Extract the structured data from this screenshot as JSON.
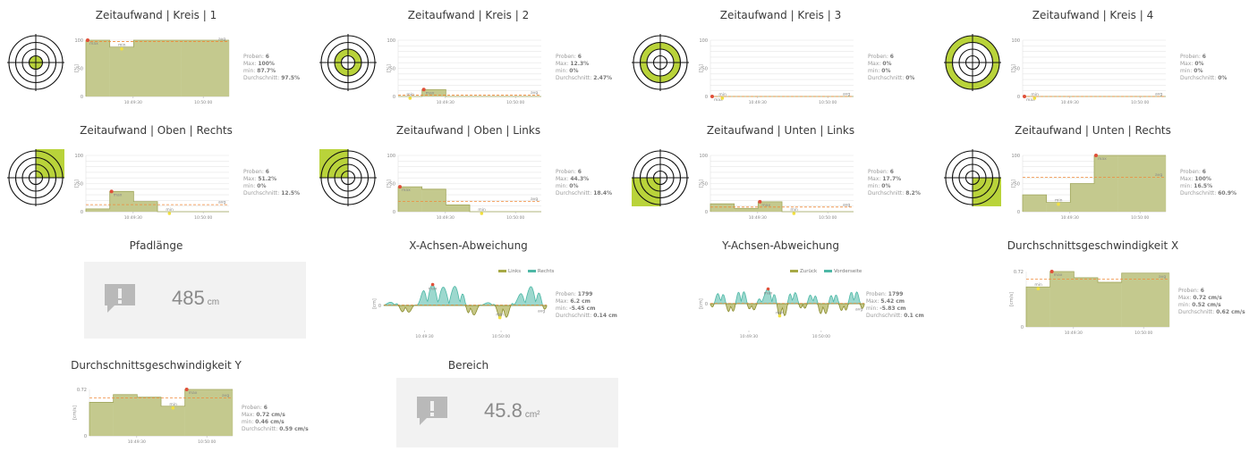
{
  "colors": {
    "bar_fill": "#c4c98e",
    "bar_stroke": "#a2a85e",
    "accent": "#b9d33a",
    "avg_line": "#f08a3a",
    "max_line": "#f08a3a",
    "max_dot": "#e0503a",
    "min_dot": "#f2e040",
    "teal": "#4db8a6",
    "olive": "#a7a946",
    "tile_bg": "#f2f2f2",
    "tile_icon": "#b9b9b9"
  },
  "time_ticks": [
    "10:49:30",
    "10:50:00"
  ],
  "marker_labels": {
    "max": "max",
    "min": "min",
    "avg": "avg"
  },
  "stat_labels": {
    "samples": "Proben:",
    "max": "Max:",
    "min": "min:",
    "avg": "Durchschnitt:"
  },
  "percent_axis": {
    "ticks": [
      "0",
      "50",
      "100"
    ],
    "unit": "[%]"
  },
  "panels": [
    {
      "title": "Zeitaufwand | Kreis | 1",
      "target_zone": "ring1",
      "stats": {
        "samples": "6",
        "max": "100%",
        "min": "87.7%",
        "avg": "97.5%"
      },
      "chart_data": {
        "type": "bar",
        "y_unit": "%",
        "ylim": [
          0,
          100
        ],
        "values": [
          100,
          87.7,
          100,
          100,
          100,
          100
        ],
        "avg": 97.5
      }
    },
    {
      "title": "Zeitaufwand | Kreis | 2",
      "target_zone": "ring2",
      "stats": {
        "samples": "6",
        "max": "12.3%",
        "min": "0%",
        "avg": "2.47%"
      },
      "chart_data": {
        "type": "bar",
        "y_unit": "%",
        "ylim": [
          0,
          100
        ],
        "values": [
          0,
          12.3,
          0,
          0,
          0,
          0
        ],
        "avg": 2.47
      }
    },
    {
      "title": "Zeitaufwand | Kreis | 3",
      "target_zone": "ring3",
      "stats": {
        "samples": "6",
        "max": "0%",
        "min": "0%",
        "avg": "0%"
      },
      "chart_data": {
        "type": "bar",
        "y_unit": "%",
        "ylim": [
          0,
          100
        ],
        "values": [
          0,
          0,
          0,
          0,
          0,
          0
        ],
        "avg": 0
      }
    },
    {
      "title": "Zeitaufwand | Kreis | 4",
      "target_zone": "ring4",
      "stats": {
        "samples": "6",
        "max": "0%",
        "min": "0%",
        "avg": "0%"
      },
      "chart_data": {
        "type": "bar",
        "y_unit": "%",
        "ylim": [
          0,
          100
        ],
        "values": [
          0,
          0,
          0,
          0,
          0,
          0
        ],
        "avg": 0
      }
    },
    {
      "title": "Zeitaufwand | Oben | Rechts",
      "target_zone": "top-right",
      "stats": {
        "samples": "6",
        "max": "51.2%",
        "min": "0%",
        "avg": "12.5%"
      },
      "chart_data": {
        "type": "bar",
        "y_unit": "%",
        "ylim": [
          0,
          100
        ],
        "values": [
          5,
          36,
          18,
          0,
          0,
          0
        ],
        "avg": 12.5
      }
    },
    {
      "title": "Zeitaufwand | Oben | Links",
      "target_zone": "top-left",
      "stats": {
        "samples": "6",
        "max": "44.3%",
        "min": "0%",
        "avg": "18.4%"
      },
      "chart_data": {
        "type": "bar",
        "y_unit": "%",
        "ylim": [
          0,
          100
        ],
        "values": [
          44.3,
          40,
          12,
          0,
          0,
          0
        ],
        "avg": 18.4
      }
    },
    {
      "title": "Zeitaufwand | Unten | Links",
      "target_zone": "bottom-left",
      "stats": {
        "samples": "6",
        "max": "17.7%",
        "min": "0%",
        "avg": "8.2%"
      },
      "chart_data": {
        "type": "bar",
        "y_unit": "%",
        "ylim": [
          0,
          100
        ],
        "values": [
          14,
          6,
          17.7,
          0,
          0,
          0
        ],
        "avg": 8.2
      }
    },
    {
      "title": "Zeitaufwand | Unten | Rechts",
      "target_zone": "bottom-right",
      "stats": {
        "samples": "6",
        "max": "100%",
        "min": "16.5%",
        "avg": "60.9%"
      },
      "chart_data": {
        "type": "bar",
        "y_unit": "%",
        "ylim": [
          0,
          100
        ],
        "values": [
          30,
          16.5,
          50,
          100,
          100,
          100
        ],
        "avg": 60.9
      }
    }
  ],
  "path_length": {
    "title": "Pfadlänge",
    "value": "485",
    "unit": "cm"
  },
  "x_deviation": {
    "title": "X-Achsen-Abweichung",
    "legend": [
      "Links",
      "Rechts"
    ],
    "y_unit": "[cm]",
    "stats": {
      "samples": "1799",
      "max": "6.2 cm",
      "min": "-5.45 cm",
      "avg": "0.14 cm"
    },
    "chart_data": {
      "type": "area",
      "ylim": [
        -6,
        7
      ],
      "peaks": [
        0.5,
        1.2,
        -3,
        0.4,
        6.2,
        5.5,
        4.8,
        5.9,
        -4.2,
        0.5,
        1.0,
        -5.45,
        1.5,
        4.5,
        6.0,
        -2.5
      ],
      "avg": 0.14
    }
  },
  "y_deviation": {
    "title": "Y-Achsen-Abweichung",
    "legend": [
      "Zurück",
      "Vorderseite"
    ],
    "y_unit": "[cm]",
    "stats": {
      "samples": "1799",
      "max": "5.42 cm",
      "min": "-5.83 cm",
      "avg": "0.1 cm"
    },
    "chart_data": {
      "type": "area",
      "ylim": [
        -6,
        6
      ],
      "peaks": [
        -2,
        4.5,
        -4,
        5.42,
        -3,
        2.5,
        4.8,
        -5.83,
        5.0,
        -2.5,
        4.0,
        -4.8,
        4.2,
        -3.5,
        5.3,
        -2.8
      ],
      "avg": 0.1
    }
  },
  "speed_x": {
    "title": "Durchschnittsgeschwindigkeit X",
    "y_unit": "[cm/s]",
    "y_tick_top": "0.72",
    "y_tick_zero": "0",
    "stats": {
      "samples": "6",
      "max": "0.72 cm/s",
      "min": "0.52 cm/s",
      "avg": "0.62 cm/s"
    },
    "chart_data": {
      "type": "bar",
      "ylim": [
        0,
        0.72
      ],
      "values": [
        0.52,
        0.72,
        0.64,
        0.58,
        0.7,
        0.7
      ],
      "avg": 0.62
    }
  },
  "speed_y": {
    "title": "Durchschnittsgeschwindigkeit Y",
    "y_unit": "[cm/s]",
    "y_tick_top": "0.72",
    "y_tick_zero": "0",
    "stats": {
      "samples": "6",
      "max": "0.72 cm/s",
      "min": "0.46 cm/s",
      "avg": "0.59 cm/s"
    },
    "chart_data": {
      "type": "bar",
      "ylim": [
        0,
        0.72
      ],
      "values": [
        0.52,
        0.64,
        0.6,
        0.46,
        0.72,
        0.72
      ],
      "avg": 0.59
    }
  },
  "area": {
    "title": "Bereich",
    "value": "45.8",
    "unit": "cm²"
  }
}
